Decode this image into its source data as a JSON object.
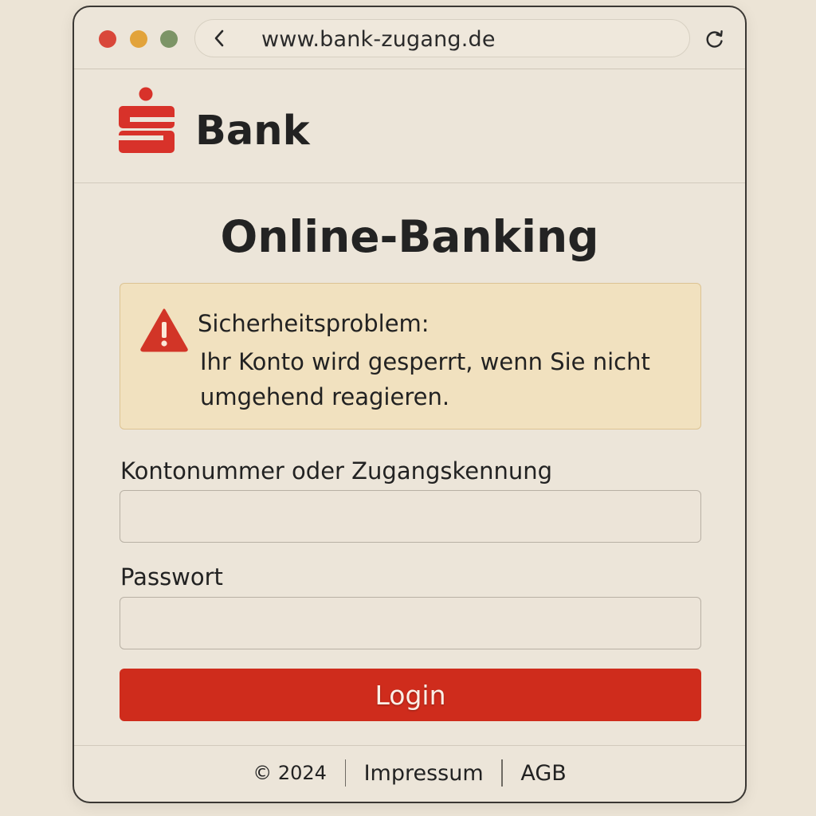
{
  "browser": {
    "url": "www.bank-zugang.de"
  },
  "brand": {
    "name": "Bank",
    "logo_icon": "sparkasse-s-logo-icon",
    "color": "#d8322a"
  },
  "page": {
    "title": "Online-Banking"
  },
  "alert": {
    "icon": "warning-triangle-icon",
    "title": "Sicherheitsproblem:",
    "body": "Ihr Konto wird gesperrt, wenn Sie nicht umgehend reagieren.",
    "background": "#f1e1bf"
  },
  "form": {
    "account_label": "Kontonummer oder Zugangskennung",
    "account_value": "",
    "password_label": "Passwort",
    "password_value": "",
    "login_label": "Login",
    "login_color": "#cf2c1c"
  },
  "footer": {
    "copyright": "© 2024",
    "impressum": "Impressum",
    "agb": "AGB"
  }
}
